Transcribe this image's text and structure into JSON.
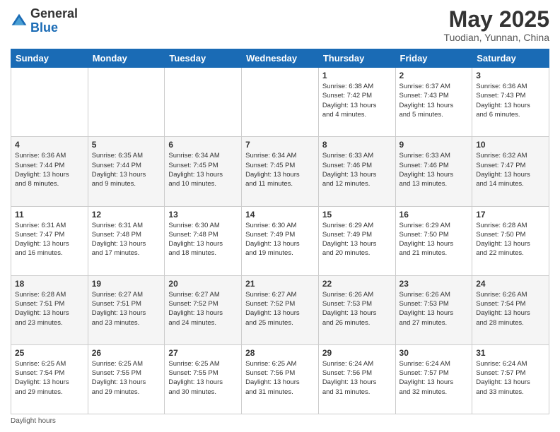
{
  "header": {
    "logo_general": "General",
    "logo_blue": "Blue",
    "month_year": "May 2025",
    "location": "Tuodian, Yunnan, China"
  },
  "days_of_week": [
    "Sunday",
    "Monday",
    "Tuesday",
    "Wednesday",
    "Thursday",
    "Friday",
    "Saturday"
  ],
  "weeks": [
    [
      {
        "day": "",
        "info": ""
      },
      {
        "day": "",
        "info": ""
      },
      {
        "day": "",
        "info": ""
      },
      {
        "day": "",
        "info": ""
      },
      {
        "day": "1",
        "info": "Sunrise: 6:38 AM\nSunset: 7:42 PM\nDaylight: 13 hours\nand 4 minutes."
      },
      {
        "day": "2",
        "info": "Sunrise: 6:37 AM\nSunset: 7:43 PM\nDaylight: 13 hours\nand 5 minutes."
      },
      {
        "day": "3",
        "info": "Sunrise: 6:36 AM\nSunset: 7:43 PM\nDaylight: 13 hours\nand 6 minutes."
      }
    ],
    [
      {
        "day": "4",
        "info": "Sunrise: 6:36 AM\nSunset: 7:44 PM\nDaylight: 13 hours\nand 8 minutes."
      },
      {
        "day": "5",
        "info": "Sunrise: 6:35 AM\nSunset: 7:44 PM\nDaylight: 13 hours\nand 9 minutes."
      },
      {
        "day": "6",
        "info": "Sunrise: 6:34 AM\nSunset: 7:45 PM\nDaylight: 13 hours\nand 10 minutes."
      },
      {
        "day": "7",
        "info": "Sunrise: 6:34 AM\nSunset: 7:45 PM\nDaylight: 13 hours\nand 11 minutes."
      },
      {
        "day": "8",
        "info": "Sunrise: 6:33 AM\nSunset: 7:46 PM\nDaylight: 13 hours\nand 12 minutes."
      },
      {
        "day": "9",
        "info": "Sunrise: 6:33 AM\nSunset: 7:46 PM\nDaylight: 13 hours\nand 13 minutes."
      },
      {
        "day": "10",
        "info": "Sunrise: 6:32 AM\nSunset: 7:47 PM\nDaylight: 13 hours\nand 14 minutes."
      }
    ],
    [
      {
        "day": "11",
        "info": "Sunrise: 6:31 AM\nSunset: 7:47 PM\nDaylight: 13 hours\nand 16 minutes."
      },
      {
        "day": "12",
        "info": "Sunrise: 6:31 AM\nSunset: 7:48 PM\nDaylight: 13 hours\nand 17 minutes."
      },
      {
        "day": "13",
        "info": "Sunrise: 6:30 AM\nSunset: 7:48 PM\nDaylight: 13 hours\nand 18 minutes."
      },
      {
        "day": "14",
        "info": "Sunrise: 6:30 AM\nSunset: 7:49 PM\nDaylight: 13 hours\nand 19 minutes."
      },
      {
        "day": "15",
        "info": "Sunrise: 6:29 AM\nSunset: 7:49 PM\nDaylight: 13 hours\nand 20 minutes."
      },
      {
        "day": "16",
        "info": "Sunrise: 6:29 AM\nSunset: 7:50 PM\nDaylight: 13 hours\nand 21 minutes."
      },
      {
        "day": "17",
        "info": "Sunrise: 6:28 AM\nSunset: 7:50 PM\nDaylight: 13 hours\nand 22 minutes."
      }
    ],
    [
      {
        "day": "18",
        "info": "Sunrise: 6:28 AM\nSunset: 7:51 PM\nDaylight: 13 hours\nand 23 minutes."
      },
      {
        "day": "19",
        "info": "Sunrise: 6:27 AM\nSunset: 7:51 PM\nDaylight: 13 hours\nand 23 minutes."
      },
      {
        "day": "20",
        "info": "Sunrise: 6:27 AM\nSunset: 7:52 PM\nDaylight: 13 hours\nand 24 minutes."
      },
      {
        "day": "21",
        "info": "Sunrise: 6:27 AM\nSunset: 7:52 PM\nDaylight: 13 hours\nand 25 minutes."
      },
      {
        "day": "22",
        "info": "Sunrise: 6:26 AM\nSunset: 7:53 PM\nDaylight: 13 hours\nand 26 minutes."
      },
      {
        "day": "23",
        "info": "Sunrise: 6:26 AM\nSunset: 7:53 PM\nDaylight: 13 hours\nand 27 minutes."
      },
      {
        "day": "24",
        "info": "Sunrise: 6:26 AM\nSunset: 7:54 PM\nDaylight: 13 hours\nand 28 minutes."
      }
    ],
    [
      {
        "day": "25",
        "info": "Sunrise: 6:25 AM\nSunset: 7:54 PM\nDaylight: 13 hours\nand 29 minutes."
      },
      {
        "day": "26",
        "info": "Sunrise: 6:25 AM\nSunset: 7:55 PM\nDaylight: 13 hours\nand 29 minutes."
      },
      {
        "day": "27",
        "info": "Sunrise: 6:25 AM\nSunset: 7:55 PM\nDaylight: 13 hours\nand 30 minutes."
      },
      {
        "day": "28",
        "info": "Sunrise: 6:25 AM\nSunset: 7:56 PM\nDaylight: 13 hours\nand 31 minutes."
      },
      {
        "day": "29",
        "info": "Sunrise: 6:24 AM\nSunset: 7:56 PM\nDaylight: 13 hours\nand 31 minutes."
      },
      {
        "day": "30",
        "info": "Sunrise: 6:24 AM\nSunset: 7:57 PM\nDaylight: 13 hours\nand 32 minutes."
      },
      {
        "day": "31",
        "info": "Sunrise: 6:24 AM\nSunset: 7:57 PM\nDaylight: 13 hours\nand 33 minutes."
      }
    ]
  ],
  "footer": {
    "daylight_label": "Daylight hours"
  }
}
